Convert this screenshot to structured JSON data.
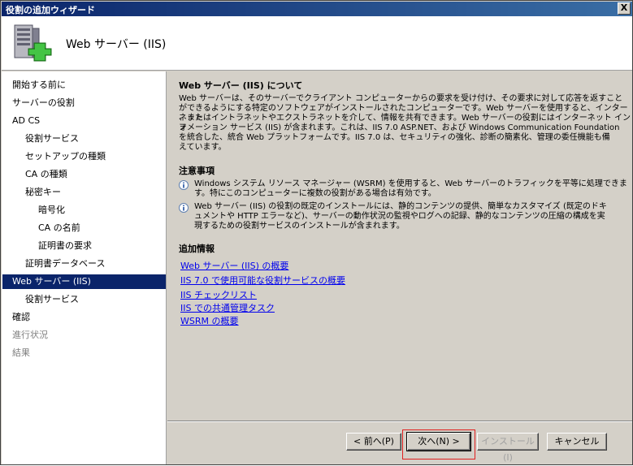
{
  "window": {
    "title": "役割の追加ウィザード",
    "close_glyph": "X"
  },
  "header": {
    "title": "Web サーバー (IIS)"
  },
  "sidebar": {
    "items": [
      {
        "label": "開始する前に",
        "state": "normal"
      },
      {
        "label": "サーバーの役割",
        "state": "normal"
      },
      {
        "label": "AD CS",
        "state": "normal"
      },
      {
        "label": "役割サービス",
        "state": "normal"
      },
      {
        "label": "セットアップの種類",
        "state": "normal"
      },
      {
        "label": "CA の種類",
        "state": "normal"
      },
      {
        "label": "秘密キー",
        "state": "normal"
      },
      {
        "label": "暗号化",
        "state": "normal"
      },
      {
        "label": "CA の名前",
        "state": "normal"
      },
      {
        "label": "証明書の要求",
        "state": "normal"
      },
      {
        "label": "証明書データベース",
        "state": "normal"
      },
      {
        "label": "Web サーバー (IIS)",
        "state": "active"
      },
      {
        "label": "役割サービス",
        "state": "normal"
      },
      {
        "label": "確認",
        "state": "normal"
      },
      {
        "label": "進行状況",
        "state": "disabled"
      },
      {
        "label": "結果",
        "state": "disabled"
      }
    ]
  },
  "main": {
    "about_title": "Web サーバー (IIS) について",
    "about_lines": [
      "Web サーバーは、そのサーバーでクライアント コンピューターからの要求を受け付け、その要求に対して応答を返すこと",
      "ができるようにする特定のソフトウェアがインストールされたコンピューターです。Web サーバーを使用すると、インターネット",
      "、またはイントラネットやエクストラネットを介して、情報を共有できます。Web サーバーの役割にはインターネット インフ",
      "ォメーション サービス (IIS) が含まれます。これは、IIS 7.0 ASP.NET、および Windows Communication Foundation",
      "を統合した、統合 Web プラットフォームです。IIS 7.0 は、セキュリティの強化、診断の簡素化、管理の委任機能も備",
      "えています。"
    ],
    "notes_title": "注意事項",
    "note1_lines": [
      "Windows システム リソース マネージャー (WSRM) を使用すると、Web サーバーのトラフィックを平等に処理できま",
      "す。特にこのコンピューターに複数の役割がある場合は有効です。"
    ],
    "note2_lines": [
      "Web サーバー (IIS) の役割の既定のインストールには、静的コンテンツの提供、簡単なカスタマイズ (既定のドキ",
      "ュメントや HTTP エラーなど)、サーバーの動作状況の監視やログへの記録、静的なコンテンツの圧縮の構成を実",
      "現するための役割サービスのインストールが含まれます。"
    ],
    "more_title": "追加情報",
    "links": [
      "Web サーバー (IIS) の概要",
      "IIS 7.0 で使用可能な役割サービスの概要",
      "IIS チェックリスト",
      "IIS での共通管理タスク",
      "WSRM の概要"
    ]
  },
  "footer": {
    "back_label": "< 前へ(P)",
    "next_label": "次へ(N) >",
    "install_label": "インストール(I)",
    "cancel_label": "キャンセル"
  },
  "colors": {
    "titlebar": "#0a246a",
    "selection": "#0a246a",
    "link": "#0000ee",
    "highlight_box": "#e02020"
  }
}
